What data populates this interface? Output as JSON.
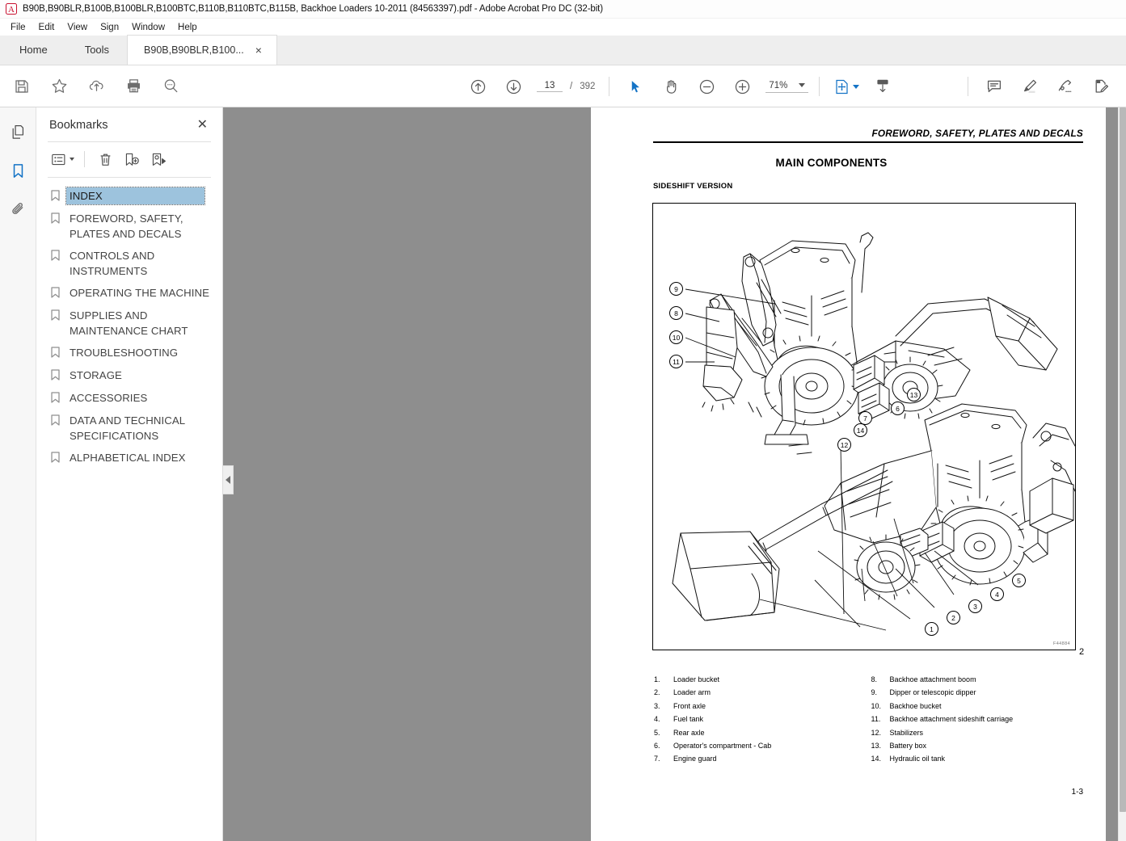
{
  "window": {
    "title": "B90B,B90BLR,B100B,B100BLR,B100BTC,B110B,B110BTC,B115B, Backhoe Loaders 10-2011 (84563397).pdf - Adobe Acrobat Pro DC (32-bit)",
    "app_icon": "acrobat-logo-icon"
  },
  "menubar": {
    "items": [
      {
        "label": "File"
      },
      {
        "label": "Edit"
      },
      {
        "label": "View"
      },
      {
        "label": "Sign"
      },
      {
        "label": "Window"
      },
      {
        "label": "Help"
      }
    ]
  },
  "tabs": {
    "home": "Home",
    "tools": "Tools",
    "document": "B90B,B90BLR,B100...",
    "close_glyph": "×"
  },
  "toolbar": {
    "left_tools": [
      {
        "name": "save-icon",
        "tooltip": "Save"
      },
      {
        "name": "star-icon",
        "tooltip": "Add to favorites"
      },
      {
        "name": "upload-cloud-icon",
        "tooltip": "Send file"
      },
      {
        "name": "print-icon",
        "tooltip": "Print file"
      },
      {
        "name": "search-icon",
        "tooltip": "Find text"
      }
    ],
    "prev_page": "previous-page-icon",
    "next_page": "next-page-icon",
    "page_number": "13",
    "page_separator": "/",
    "page_total": "392",
    "select_tool": "cursor-select-icon",
    "hand_tool": "hand-pan-icon",
    "zoom_out": "zoom-out-icon",
    "zoom_in": "zoom-in-icon",
    "zoom_level": "71%",
    "fit_page": "fit-page-icon",
    "scroll_mode": "page-scroll-icon",
    "right_tools": [
      {
        "name": "comment-icon",
        "tooltip": "Add comment"
      },
      {
        "name": "highlight-icon",
        "tooltip": "Highlight text"
      },
      {
        "name": "sign-icon",
        "tooltip": "Sign"
      },
      {
        "name": "fill-sign-icon",
        "tooltip": "Fill & Sign"
      }
    ]
  },
  "navrail": {
    "items": [
      {
        "name": "page-thumbnails-icon",
        "label": "Page Thumbnails",
        "selected": false
      },
      {
        "name": "bookmarks-icon",
        "label": "Bookmarks",
        "selected": true
      },
      {
        "name": "attachments-icon",
        "label": "Attachments",
        "selected": false
      }
    ],
    "selected_color": "#1473c6"
  },
  "bookmarks_panel": {
    "title": "Bookmarks",
    "close_glyph": "✕",
    "tools": [
      {
        "name": "bookmark-options-icon",
        "label": "Options"
      },
      {
        "name": "delete-bookmark-icon",
        "label": "Delete"
      },
      {
        "name": "new-bookmark-icon",
        "label": "New bookmark"
      },
      {
        "name": "goto-bookmark-icon",
        "label": "Go to bookmark"
      }
    ],
    "items": [
      {
        "label": "INDEX",
        "selected": true
      },
      {
        "label": "FOREWORD, SAFETY, PLATES AND DECALS",
        "selected": false
      },
      {
        "label": "CONTROLS AND INSTRUMENTS",
        "selected": false
      },
      {
        "label": "OPERATING THE MACHINE",
        "selected": false
      },
      {
        "label": "SUPPLIES AND MAINTENANCE CHART",
        "selected": false
      },
      {
        "label": "TROUBLESHOOTING",
        "selected": false
      },
      {
        "label": "STORAGE",
        "selected": false
      },
      {
        "label": "ACCESSORIES",
        "selected": false
      },
      {
        "label": "DATA AND TECHNICAL SPECIFICATIONS",
        "selected": false
      },
      {
        "label": "ALPHABETICAL INDEX",
        "selected": false
      }
    ],
    "selection_color": "#9dc3dd"
  },
  "document": {
    "running_header": "FOREWORD, SAFETY, PLATES AND DECALS",
    "heading": "MAIN COMPONENTS",
    "subheading": "SIDESHIFT VERSION",
    "figure_code": "F44884",
    "figure_number": "2",
    "page_folio": "1-3",
    "callouts": [
      "9",
      "8",
      "10",
      "11",
      "13",
      "6",
      "7",
      "14",
      "12",
      "5",
      "4",
      "3",
      "2",
      "1"
    ],
    "legend_left": [
      {
        "num": "1.",
        "text": "Loader bucket"
      },
      {
        "num": "2.",
        "text": "Loader arm"
      },
      {
        "num": "3.",
        "text": "Front axle"
      },
      {
        "num": "4.",
        "text": "Fuel tank"
      },
      {
        "num": "5.",
        "text": "Rear axle"
      },
      {
        "num": "6.",
        "text": "Operator's compartment - Cab"
      },
      {
        "num": "7.",
        "text": "Engine guard"
      }
    ],
    "legend_right": [
      {
        "num": "8.",
        "text": "Backhoe attachment boom"
      },
      {
        "num": "9.",
        "text": "Dipper or telescopic dipper"
      },
      {
        "num": "10.",
        "text": "Backhoe bucket"
      },
      {
        "num": "11.",
        "text": "Backhoe attachment sideshift carriage"
      },
      {
        "num": "12.",
        "text": "Stabilizers"
      },
      {
        "num": "13.",
        "text": "Battery box"
      },
      {
        "num": "14.",
        "text": "Hydraulic oil tank"
      }
    ]
  },
  "colors": {
    "accent": "#1473c6",
    "viewer_bg": "#8e8e8e",
    "tabstrip_bg": "#eeeeee"
  }
}
